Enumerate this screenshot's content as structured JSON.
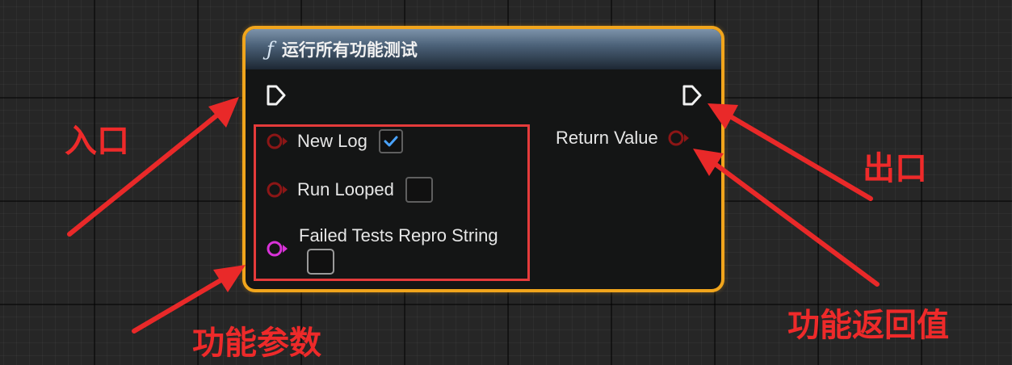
{
  "node": {
    "title": "运行所有功能测试",
    "function_icon": "function-f-icon",
    "exec_in_icon": "exec-in-pin-icon",
    "exec_out_icon": "exec-out-pin-icon",
    "inputs": [
      {
        "label": "New Log",
        "checked": true
      },
      {
        "label": "Run Looped",
        "checked": false
      },
      {
        "label": "Failed Tests Repro String",
        "value": ""
      }
    ],
    "output": {
      "label": "Return Value"
    }
  },
  "annotations": {
    "entry": "入口",
    "exit": "出口",
    "params": "功能参数",
    "return": "功能返回值"
  },
  "colors": {
    "node_border": "#f1a51c",
    "bool_pin": "#8c1616",
    "string_pin": "#d932d9",
    "annotation_red": "#ee2a2a",
    "checkbox_check": "#4aa3ff"
  }
}
